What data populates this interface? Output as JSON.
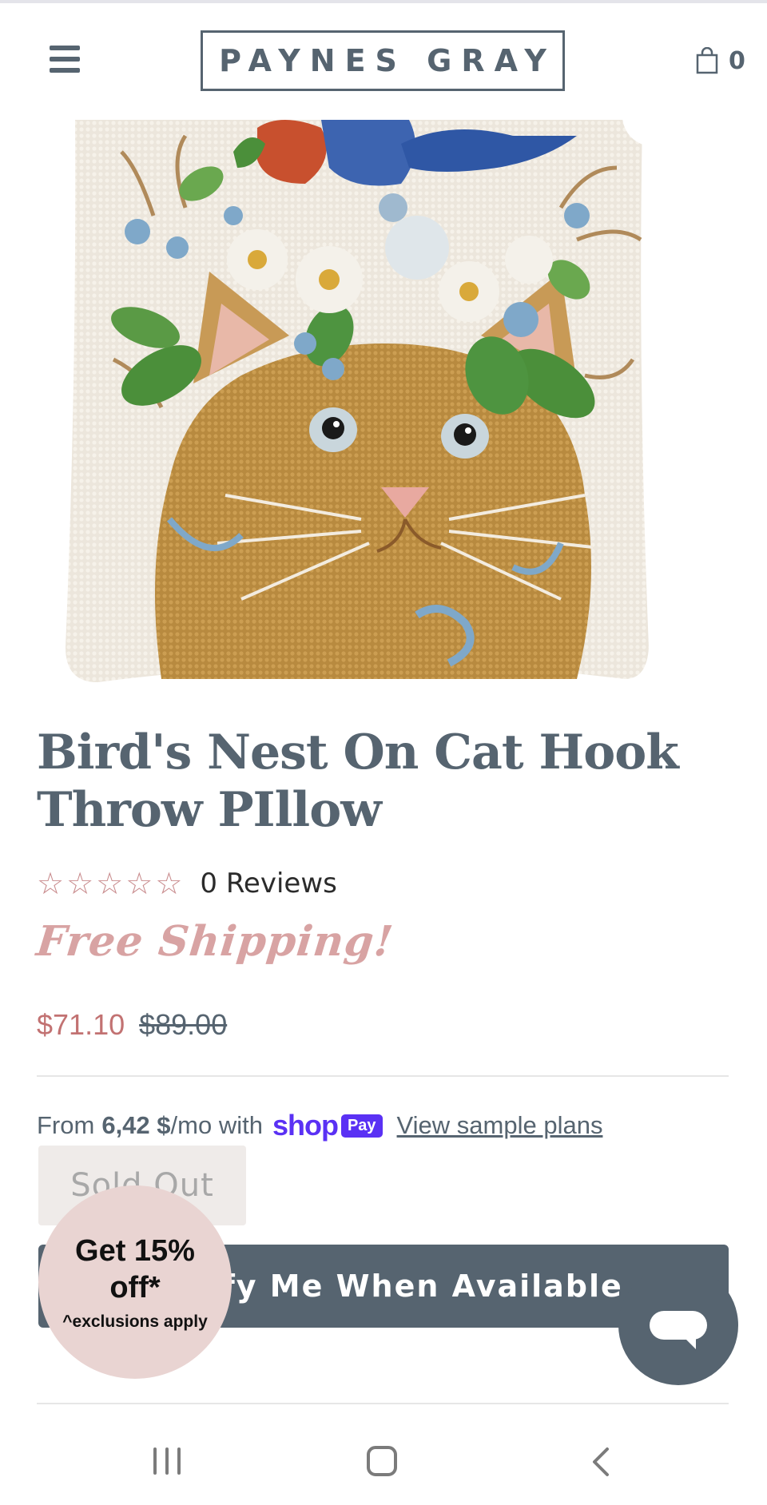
{
  "header": {
    "brand": "PAYNES GRAY",
    "cart_count": "0"
  },
  "product": {
    "title": "Bird's Nest On Cat Hook Throw PIllow",
    "rating_stars": 0,
    "rating_max": 5,
    "reviews_label": "0 Reviews",
    "free_shipping": "Free Shipping!",
    "price_sale": "$71.10",
    "price_original": "$89.00"
  },
  "shop_pay": {
    "prefix": "From",
    "amount": "6,42 $",
    "suffix": "/mo with",
    "shop_word": "shop",
    "pay_word": "Pay",
    "link": "View sample plans"
  },
  "buttons": {
    "sold_out": "Sold Out",
    "notify": "Notify Me When Available"
  },
  "discount_popup": {
    "main": "Get 15% off*",
    "note": "^exclusions apply"
  },
  "colors": {
    "brand": "#566470",
    "sale_price": "#c27272",
    "free_shipping": "#d8a3a3",
    "shop_pay": "#5a31f4",
    "badge_bg": "#e9d4d2"
  },
  "icons": {
    "menu": "hamburger-icon",
    "cart": "shopping-bag-icon",
    "star": "star-outline-icon",
    "chat": "chat-bubble-icon"
  }
}
